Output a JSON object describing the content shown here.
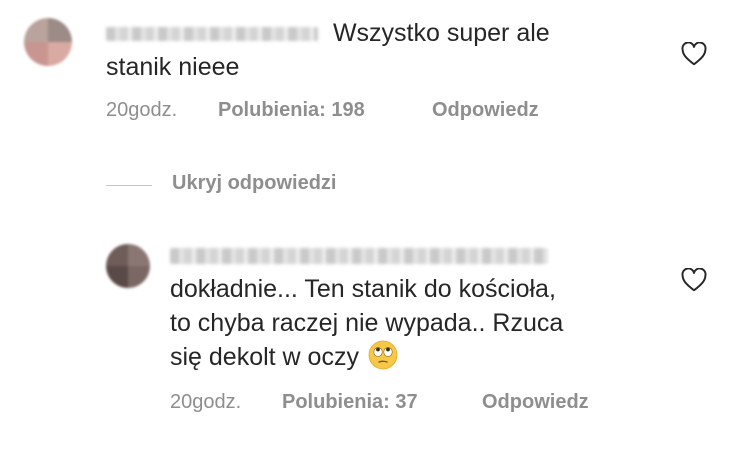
{
  "comments": [
    {
      "text_line1": "Wszystko super ale",
      "text_line2": "stanik nieee",
      "time": "20godz.",
      "likes": "Polubienia: 198",
      "reply": "Odpowiedz"
    },
    {
      "text_line1": "dokładnie... Ten stanik do kościoła,",
      "text_line2": "to chyba raczej nie wypada.. Rzuca",
      "text_line3": "się dekolt w oczy",
      "emoji": "face-with-rolling-eyes-emoji",
      "time": "20godz.",
      "likes": "Polubienia: 37",
      "reply": "Odpowiedz"
    }
  ],
  "hide_replies_label": "Ukryj odpowiedzi",
  "icons": {
    "like": "heart-outline-icon"
  },
  "colors": {
    "text": "#262626",
    "meta": "#8e8e8e",
    "divider": "#c7c7c7"
  }
}
